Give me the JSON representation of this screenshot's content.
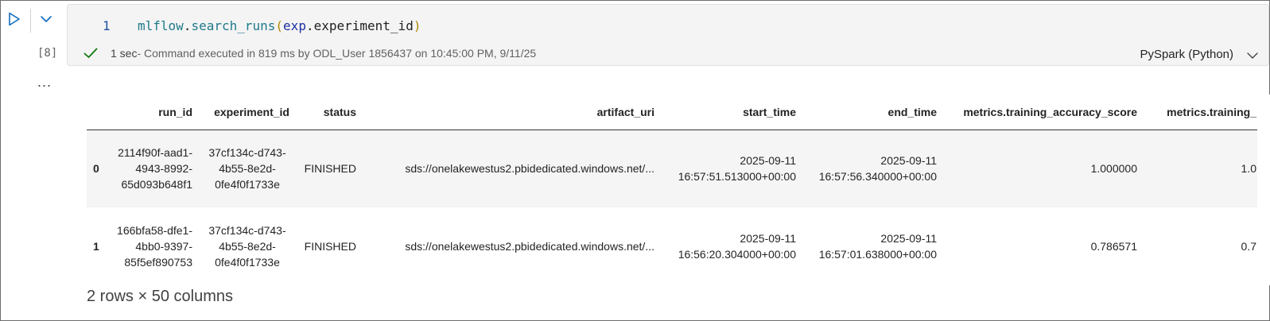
{
  "cell": {
    "line_number": "1",
    "code": {
      "module": "mlflow",
      "dot1": ".",
      "func": "search_runs",
      "open_paren": "(",
      "arg_var": "exp",
      "dot2": ".",
      "arg_attr": "experiment_id",
      "close_paren": ")"
    },
    "execution_count": "[8]",
    "status": {
      "duration": "1 sec",
      "detail": " - Command executed in 819 ms by ODL_User 1856437 on 10:45:00 PM, 9/11/25"
    },
    "language": "PySpark (Python)"
  },
  "output": {
    "menu_glyph": "...",
    "columns": [
      "",
      "run_id",
      "experiment_id",
      "status",
      "artifact_uri",
      "start_time",
      "end_time",
      "metrics.training_accuracy_score",
      "metrics.training_"
    ],
    "rows": [
      {
        "index": "0",
        "run_id": "2114f90f-aad1-4943-8992-65d093b648f1",
        "experiment_id": "37cf134c-d743-4b55-8e2d-0fe4f0f1733e",
        "status": "FINISHED",
        "artifact_uri": "sds://onelakewestus2.pbidedicated.windows.net/...",
        "start_time_date": "2025-09-11",
        "start_time_clock": "16:57:51.513000+00:00",
        "end_time_date": "2025-09-11",
        "end_time_clock": "16:57:56.340000+00:00",
        "training_accuracy_score": "1.000000",
        "training_partial": "1.0"
      },
      {
        "index": "1",
        "run_id": "166bfa58-dfe1-4bb0-9397-85f5ef890753",
        "experiment_id": "37cf134c-d743-4b55-8e2d-0fe4f0f1733e",
        "status": "FINISHED",
        "artifact_uri": "sds://onelakewestus2.pbidedicated.windows.net/...",
        "start_time_date": "2025-09-11",
        "start_time_clock": "16:56:20.304000+00:00",
        "end_time_date": "2025-09-11",
        "end_time_clock": "16:57:01.638000+00:00",
        "training_accuracy_score": "0.786571",
        "training_partial": "0.7"
      }
    ],
    "shape": "2 rows × 50 columns"
  },
  "colors": {
    "accent": "#0f6cbd",
    "success": "#0e7a0d",
    "cell_bg": "#f4f4f4"
  },
  "icons": [
    "run-icon",
    "collapse-chevron-icon",
    "checkmark-icon",
    "language-chevron-icon",
    "more-options-icon"
  ]
}
